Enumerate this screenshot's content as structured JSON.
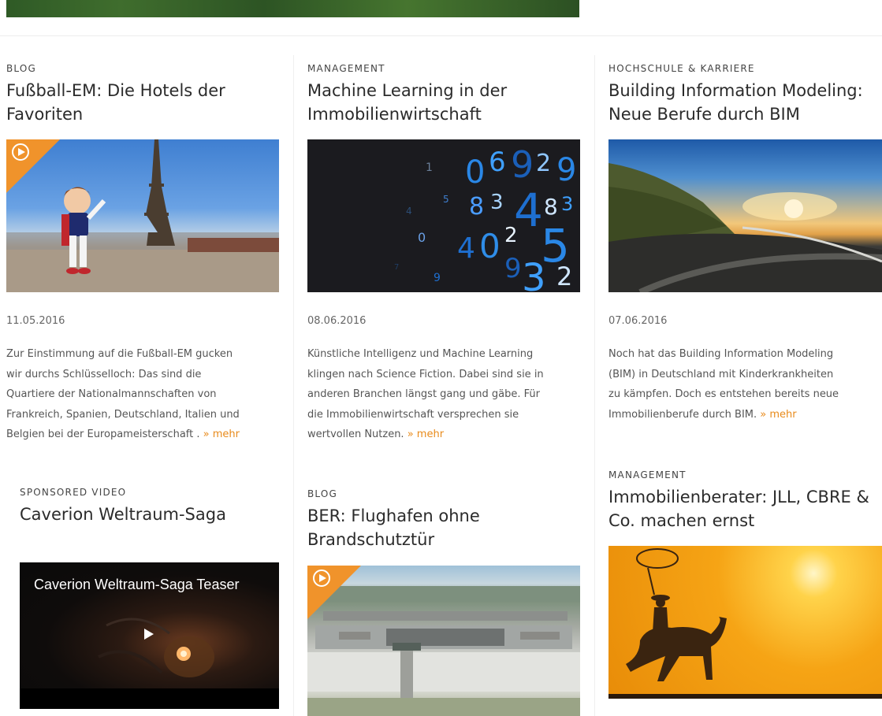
{
  "articles": [
    {
      "category": "BLOG",
      "title_line1": "Fußball-EM: Die Hotels der",
      "title_line2": "Favoriten",
      "date": "11.05.2016",
      "excerpt": [
        "Zur Einstimmung auf die Fußball-EM gucken",
        "wir durchs Schlüsselloch: Das sind die",
        "Quartiere der Nationalmannschaften von",
        "Frankreich, Spanien, Deutschland, Italien und",
        "Belgien bei der Europameisterschaft ."
      ],
      "more": "» mehr",
      "image": "eiffel-tower-mascot-image",
      "video": true
    },
    {
      "category": "MANAGEMENT",
      "title_line1": "Machine Learning in der",
      "title_line2": "Immobilienwirtschaft",
      "date": "08.06.2016",
      "excerpt": [
        "Künstliche Intelligenz und Machine Learning",
        "klingen nach Science Fiction. Dabei sind sie in",
        "anderen Branchen längst gang und gäbe. Für",
        "die Immobilienwirtschaft versprechen sie",
        "wertvollen Nutzen."
      ],
      "more": "» mehr",
      "image": "digital-numbers-image",
      "video": false
    },
    {
      "category": "HOCHSCHULE & KARRIERE",
      "title_line1": "Building Information Modeling:",
      "title_line2": "Neue Berufe durch BIM",
      "date": "07.06.2016",
      "excerpt": [
        "Noch hat das Building Information Modeling",
        "(BIM) in Deutschland mit Kinderkrankheiten",
        "zu kämpfen. Doch es entstehen bereits neue",
        "Immobilienberufe durch BIM."
      ],
      "more": "» mehr",
      "image": "road-sunset-image",
      "video": false
    },
    {
      "category": "SPONSORED VIDEO",
      "title_line1": "Caverion Weltraum-Saga",
      "title_line2": "",
      "video_title": "Caverion Weltraum-Saga Teaser",
      "image": "video-player",
      "video": false
    },
    {
      "category": "BLOG",
      "title_line1": "BER: Flughafen ohne",
      "title_line2": "Brandschutztür",
      "image": "airport-aerial-image",
      "video": true
    },
    {
      "category": "MANAGEMENT",
      "title_line1": "Immobilienberater: JLL, CBRE &",
      "title_line2": "Co. machen ernst",
      "image": "cowboy-sunset-image",
      "video": false
    }
  ],
  "colors": {
    "accent": "#e88a1a",
    "badge": "#f0932b",
    "text": "#2b2b2b"
  }
}
